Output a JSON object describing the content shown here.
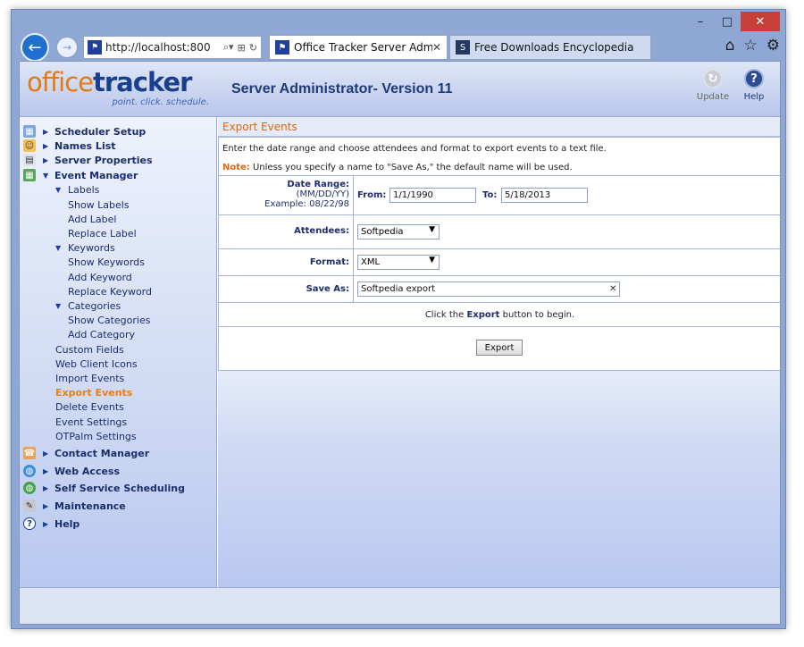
{
  "browser": {
    "url": "http://localhost:800",
    "tabs": [
      {
        "label": "Office Tracker Server Admi...",
        "active": true
      },
      {
        "label": "Free Downloads Encyclopedia",
        "active": false
      }
    ],
    "window_controls": {
      "minimize": "–",
      "maximize": "□",
      "close": "✕"
    }
  },
  "header": {
    "logo_office": "office",
    "logo_tracker": "tracker",
    "logo_tagline": "point. click. schedule.",
    "app_title": "Server Administrator- Version 11",
    "update_label": "Update",
    "help_label": "Help"
  },
  "sidebar": {
    "items": [
      {
        "label": "Scheduler Setup",
        "level": 0,
        "icon": "calendar-icon"
      },
      {
        "label": "Names List",
        "level": 0,
        "icon": "people-icon"
      },
      {
        "label": "Server Properties",
        "level": 0,
        "icon": "server-icon"
      },
      {
        "label": "Event Manager",
        "level": 0,
        "icon": "event-icon",
        "expanded": true
      },
      {
        "label": "Labels",
        "level": 1,
        "expanded": true
      },
      {
        "label": "Show Labels",
        "level": 2
      },
      {
        "label": "Add Label",
        "level": 2
      },
      {
        "label": "Replace Label",
        "level": 2
      },
      {
        "label": "Keywords",
        "level": 1,
        "expanded": true
      },
      {
        "label": "Show Keywords",
        "level": 2
      },
      {
        "label": "Add Keyword",
        "level": 2
      },
      {
        "label": "Replace Keyword",
        "level": 2
      },
      {
        "label": "Categories",
        "level": 1,
        "expanded": true
      },
      {
        "label": "Show Categories",
        "level": 2
      },
      {
        "label": "Add Category",
        "level": 2
      },
      {
        "label": "Custom Fields",
        "level": 1
      },
      {
        "label": "Web Client Icons",
        "level": 1
      },
      {
        "label": "Import Events",
        "level": 1
      },
      {
        "label": "Export Events",
        "level": 1,
        "active": true
      },
      {
        "label": "Delete Events",
        "level": 1
      },
      {
        "label": "Event Settings",
        "level": 1
      },
      {
        "label": "OTPalm Settings",
        "level": 1
      },
      {
        "label": "Contact Manager",
        "level": 0,
        "icon": "contact-icon"
      },
      {
        "label": "Web Access",
        "level": 0,
        "icon": "globe-icon"
      },
      {
        "label": "Self Service Scheduling",
        "level": 0,
        "icon": "globe-icon"
      },
      {
        "label": "Maintenance",
        "level": 0,
        "icon": "wrench-icon"
      },
      {
        "label": "Help",
        "level": 0,
        "icon": "help-icon"
      }
    ]
  },
  "main": {
    "section_title": "Export Events",
    "description": "Enter the date range and choose attendees and format to export events to a text file.",
    "note_label": "Note:",
    "note_text": " Unless you specify a name to \"Save As,\" the default name will be used.",
    "date_range": {
      "label": "Date Range:",
      "format": "(MM/DD/YY)",
      "example": "Example: 08/22/98",
      "from_label": "From:",
      "from_value": "1/1/1990",
      "to_label": "To:",
      "to_value": "5/18/2013"
    },
    "attendees": {
      "label": "Attendees:",
      "value": "Softpedia"
    },
    "format": {
      "label": "Format:",
      "value": "XML"
    },
    "save_as": {
      "label": "Save As:",
      "value": "Softpedia export"
    },
    "hint_pre": "Click the ",
    "hint_bold": "Export",
    "hint_post": " button to begin.",
    "export_button": "Export"
  }
}
